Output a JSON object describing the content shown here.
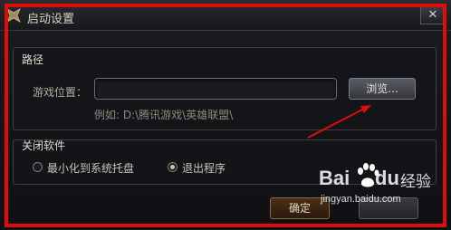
{
  "window": {
    "title": "启动设置",
    "close_glyph": "✕",
    "title_icon": "game-logo-icon"
  },
  "path_group": {
    "label": "路径",
    "field_label": "游戏位置：",
    "input_value": "",
    "browse_label": "浏览...",
    "example": "例如: D:\\腾讯游戏\\英雄联盟\\"
  },
  "close_group": {
    "label": "关闭软件",
    "options": [
      {
        "label": "最小化到系统托盘",
        "checked": false
      },
      {
        "label": "退出程序",
        "checked": true
      }
    ]
  },
  "footer": {
    "ok_label": "确定",
    "cancel_label": ""
  },
  "annotation": {
    "color": "#e00c0c"
  },
  "watermark": {
    "brand_left": "Bai",
    "brand_right": "du",
    "product": "经验",
    "url": "jingyan.baidu.com"
  }
}
